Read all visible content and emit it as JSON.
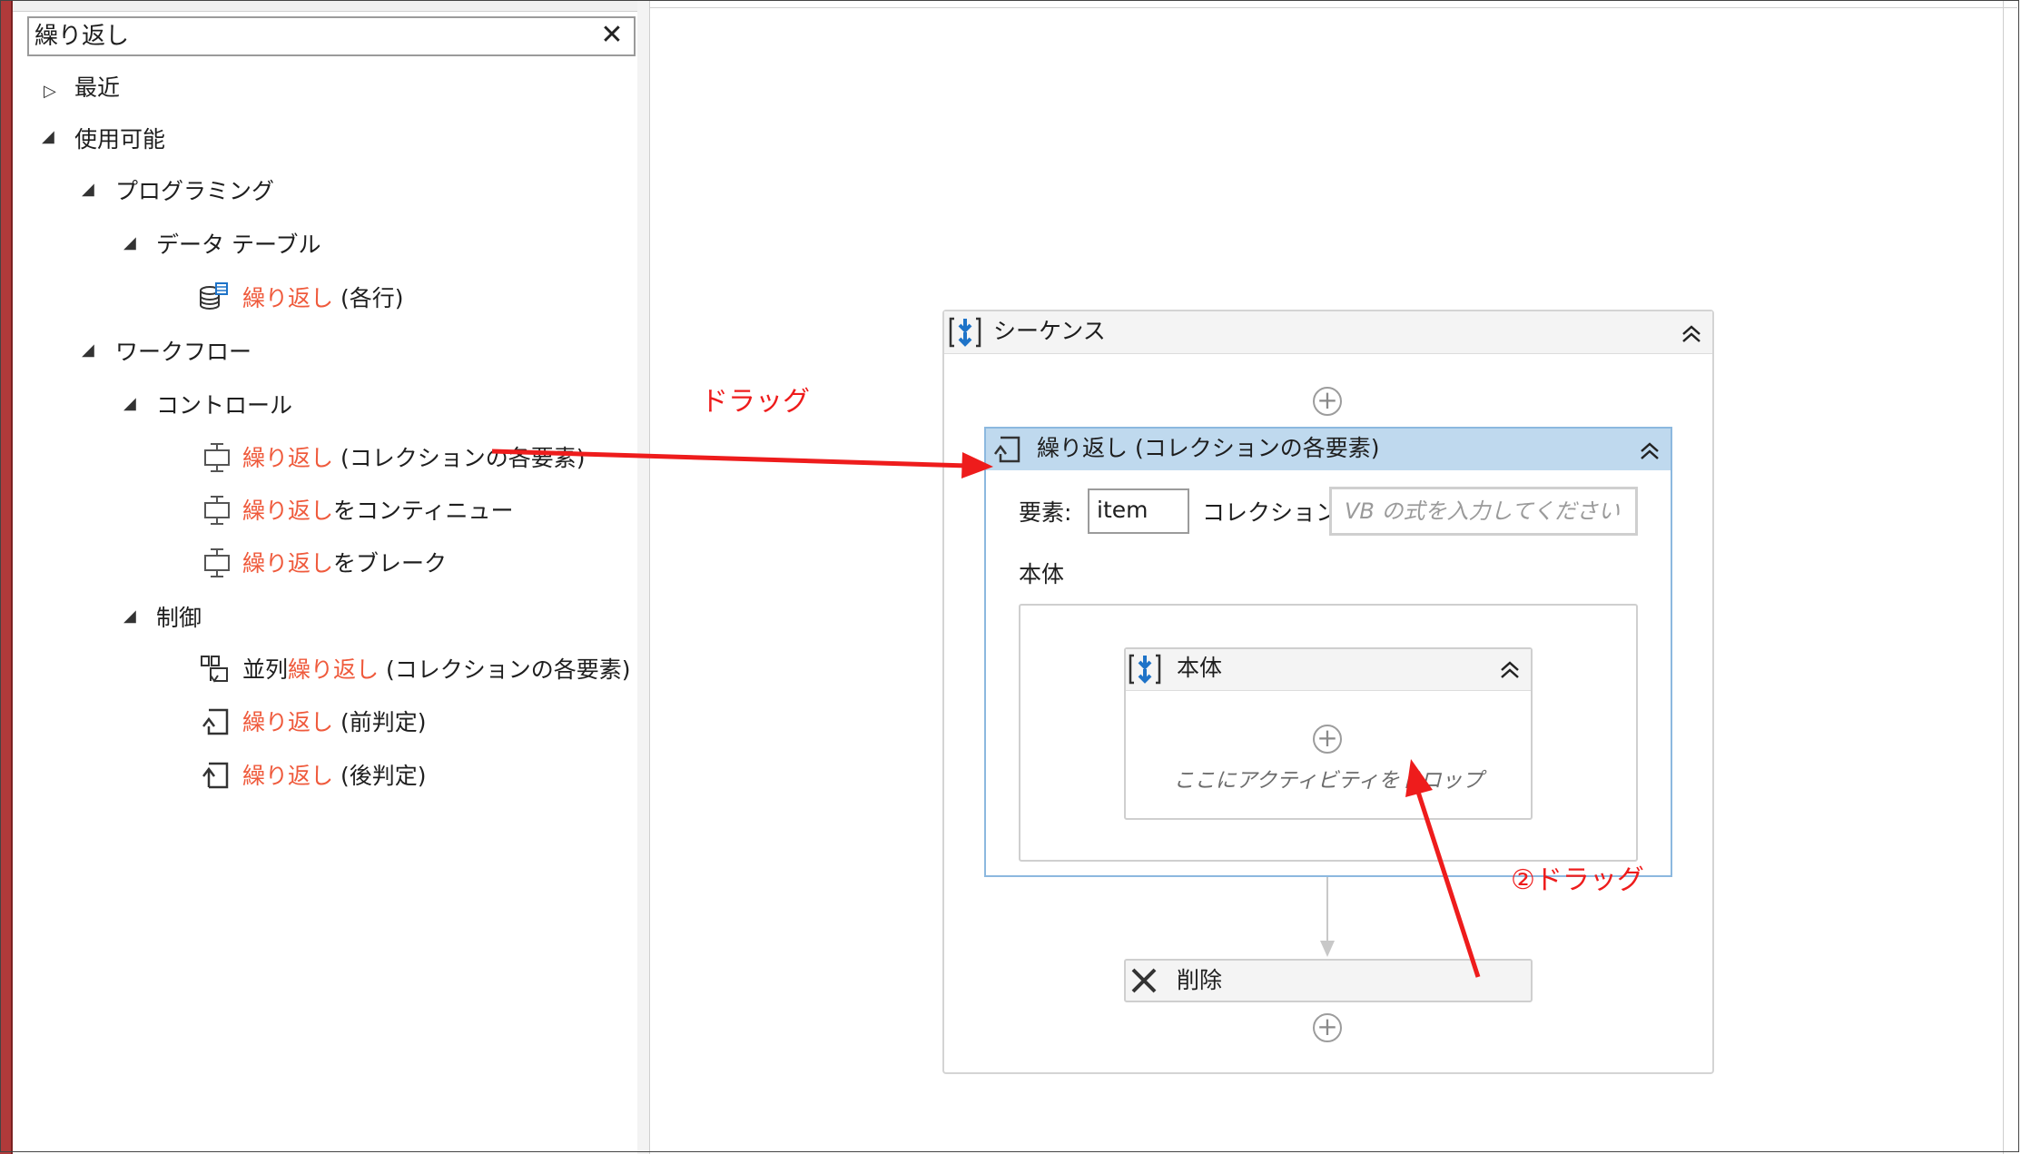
{
  "search": {
    "value": "繰り返し",
    "clear_icon": "close-icon"
  },
  "tree": {
    "recent": "最近",
    "available": "使用可能",
    "programming": "プログラミング",
    "datatable": "データ テーブル",
    "foreach_row_hl": "繰り返し",
    "foreach_row_rest": " (各行)",
    "workflow": "ワークフロー",
    "control": "コントロール",
    "foreach_hl": "繰り返し",
    "foreach_rest": " (コレクションの各要素)",
    "continue_hl": "繰り返し",
    "continue_rest": "をコンティニュー",
    "break_hl": "繰り返し",
    "break_rest": "をブレーク",
    "flow": "制御",
    "parallel_pre": "並列",
    "parallel_hl": "繰り返し",
    "parallel_rest": " (コレクションの各要素)",
    "while_hl": "繰り返し",
    "while_rest": " (前判定)",
    "dowhile_hl": "繰り返し",
    "dowhile_rest": " (後判定)"
  },
  "designer": {
    "sequence_title": "シーケンス",
    "foreach_title": "繰り返し (コレクションの各要素)",
    "item_label": "要素:",
    "item_value": "item",
    "collection_label": "コレクション:",
    "collection_placeholder": "VB の式を入力してください",
    "body_label": "本体",
    "inner_title": "本体",
    "drop_hint": "ここにアクティビティをドロップ",
    "delete_title": "削除"
  },
  "annotations": {
    "drag1": "ドラッグ",
    "drag2": "②ドラッグ",
    "color": "#ee1c1c"
  },
  "colors": {
    "highlight": "#ef5a3c",
    "foreach_header": "#bfd9ee",
    "foreach_border": "#8cb8df"
  }
}
